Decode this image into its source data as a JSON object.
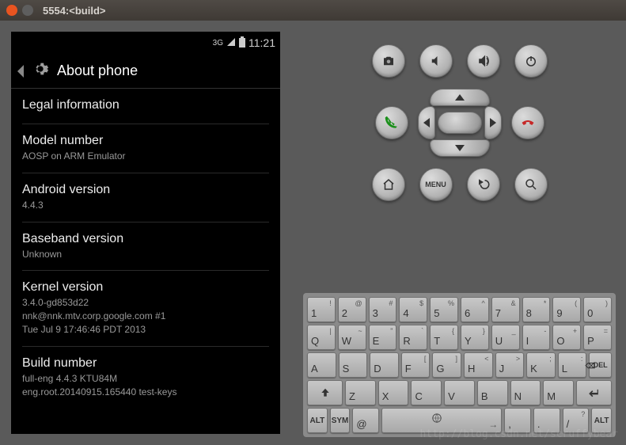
{
  "window": {
    "title": "5554:<build>"
  },
  "statusbar": {
    "net": "3G",
    "time": "11:21"
  },
  "actionbar": {
    "title": "About phone"
  },
  "items": [
    {
      "title": "Legal information",
      "sub": ""
    },
    {
      "title": "Model number",
      "sub": "AOSP on ARM Emulator"
    },
    {
      "title": "Android version",
      "sub": "4.4.3"
    },
    {
      "title": "Baseband version",
      "sub": "Unknown"
    },
    {
      "title": "Kernel version",
      "sub": "3.4.0-gd853d22\nnnk@nnk.mtv.corp.google.com #1\nTue Jul 9 17:46:46 PDT 2013"
    },
    {
      "title": "Build number",
      "sub": "full-eng 4.4.3 KTU84M\neng.root.20140915.165440 test-keys"
    }
  ],
  "hw_buttons": {
    "row1": [
      "camera",
      "vol-down",
      "vol-up",
      "power"
    ],
    "row3": [
      "home",
      "menu",
      "back",
      "search"
    ],
    "menu_label": "MENU"
  },
  "keyboard": {
    "r1": [
      [
        "1",
        "!"
      ],
      [
        "2",
        "@"
      ],
      [
        "3",
        "#"
      ],
      [
        "4",
        "$"
      ],
      [
        "5",
        "%"
      ],
      [
        "6",
        "^"
      ],
      [
        "7",
        "&"
      ],
      [
        "8",
        "*"
      ],
      [
        "9",
        "("
      ],
      [
        "0",
        ")"
      ]
    ],
    "r2": [
      [
        "Q",
        "|"
      ],
      [
        "W",
        "~"
      ],
      [
        "E",
        "\""
      ],
      [
        "R",
        "`"
      ],
      [
        "T",
        "{"
      ],
      [
        "Y",
        "}"
      ],
      [
        "U",
        "_"
      ],
      [
        "I",
        "-"
      ],
      [
        "O",
        "+"
      ],
      [
        "P",
        "="
      ]
    ],
    "r3": [
      [
        "A",
        ""
      ],
      [
        "S",
        ""
      ],
      [
        "D",
        ""
      ],
      [
        "F",
        "["
      ],
      [
        "G",
        "]"
      ],
      [
        "H",
        "<"
      ],
      [
        "J",
        ">"
      ],
      [
        "K",
        ";"
      ],
      [
        "L",
        ":"
      ]
    ],
    "r4": [
      [
        "Z",
        ""
      ],
      [
        "X",
        ""
      ],
      [
        "C",
        ""
      ],
      [
        "V",
        ""
      ],
      [
        "B",
        ""
      ],
      [
        "N",
        ""
      ],
      [
        "M",
        ""
      ]
    ],
    "r5_alt": "ALT",
    "r5_sym": "SYM",
    "r5_at": "@",
    "r5_punct": [
      [
        ",",
        ""
      ],
      [
        ".",
        ""
      ],
      [
        "/",
        "?"
      ]
    ]
  },
  "watermark": "http://blog.csdn.net/scruffybear"
}
